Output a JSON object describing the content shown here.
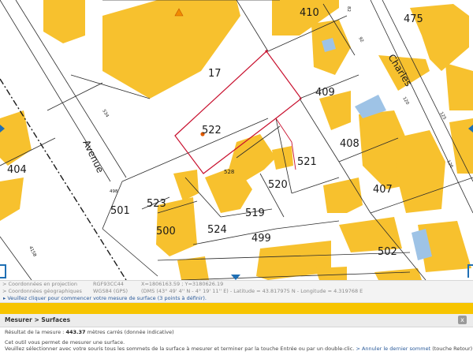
{
  "map": {
    "parcels": {
      "p17": "17",
      "p410": "410",
      "p475": "475",
      "p409": "409",
      "p522": "522",
      "p408": "408",
      "p404": "404",
      "p521": "521",
      "p528": "528",
      "p520": "520",
      "p407": "407",
      "p501": "501",
      "p523": "523",
      "p519": "519",
      "p500": "500",
      "p524": "524",
      "p499": "499",
      "p502": "502"
    },
    "streets": {
      "avenue": "Avenue",
      "charles": "Charles"
    },
    "small_numbers": {
      "n82": "82",
      "n92": "92",
      "n120": "120",
      "n125": "125",
      "n126": "126",
      "n534": "534",
      "n498": "498",
      "n415b": "415B"
    },
    "colors": {
      "building": "#f7c12e",
      "parcel_line": "#2b2b2b",
      "selection": "#c8102e",
      "water": "#9ec3e6",
      "accent": "#1f6fb4"
    }
  },
  "coords": {
    "proj_label": "Coordonnées en projection",
    "proj_system": "RGF93CC44",
    "proj_value": "X=1806163.59 ; Y=3180626.19",
    "geo_label": "Coordonnées géographiques",
    "geo_system": "WGS84 (GPS)",
    "geo_value": "(DMS (43° 49' 4'' N - 4° 19' 11'' E) - Latitude = 43.817975 N - Longitude = 4.319768 E"
  },
  "hint": "Veuillez cliquer pour commencer votre mesure de surface (3 points à définir).",
  "panel": {
    "title": "Mesurer > Surfaces",
    "close": "x",
    "result_label": "Résultat de la mesure :",
    "result_value": "443.37",
    "result_unit": "mètres carrés",
    "result_note": "(donnée indicative)",
    "desc1": "Cet outil vous permet de mesurer une surface.",
    "desc2": "Veuillez sélectionner avec votre souris tous les sommets de la surface à mesurer et terminer par la touche Entrée ou par un double-clic.",
    "undo_link": "> Annuler le dernier sommet",
    "undo_key": "(touche Retour)"
  }
}
